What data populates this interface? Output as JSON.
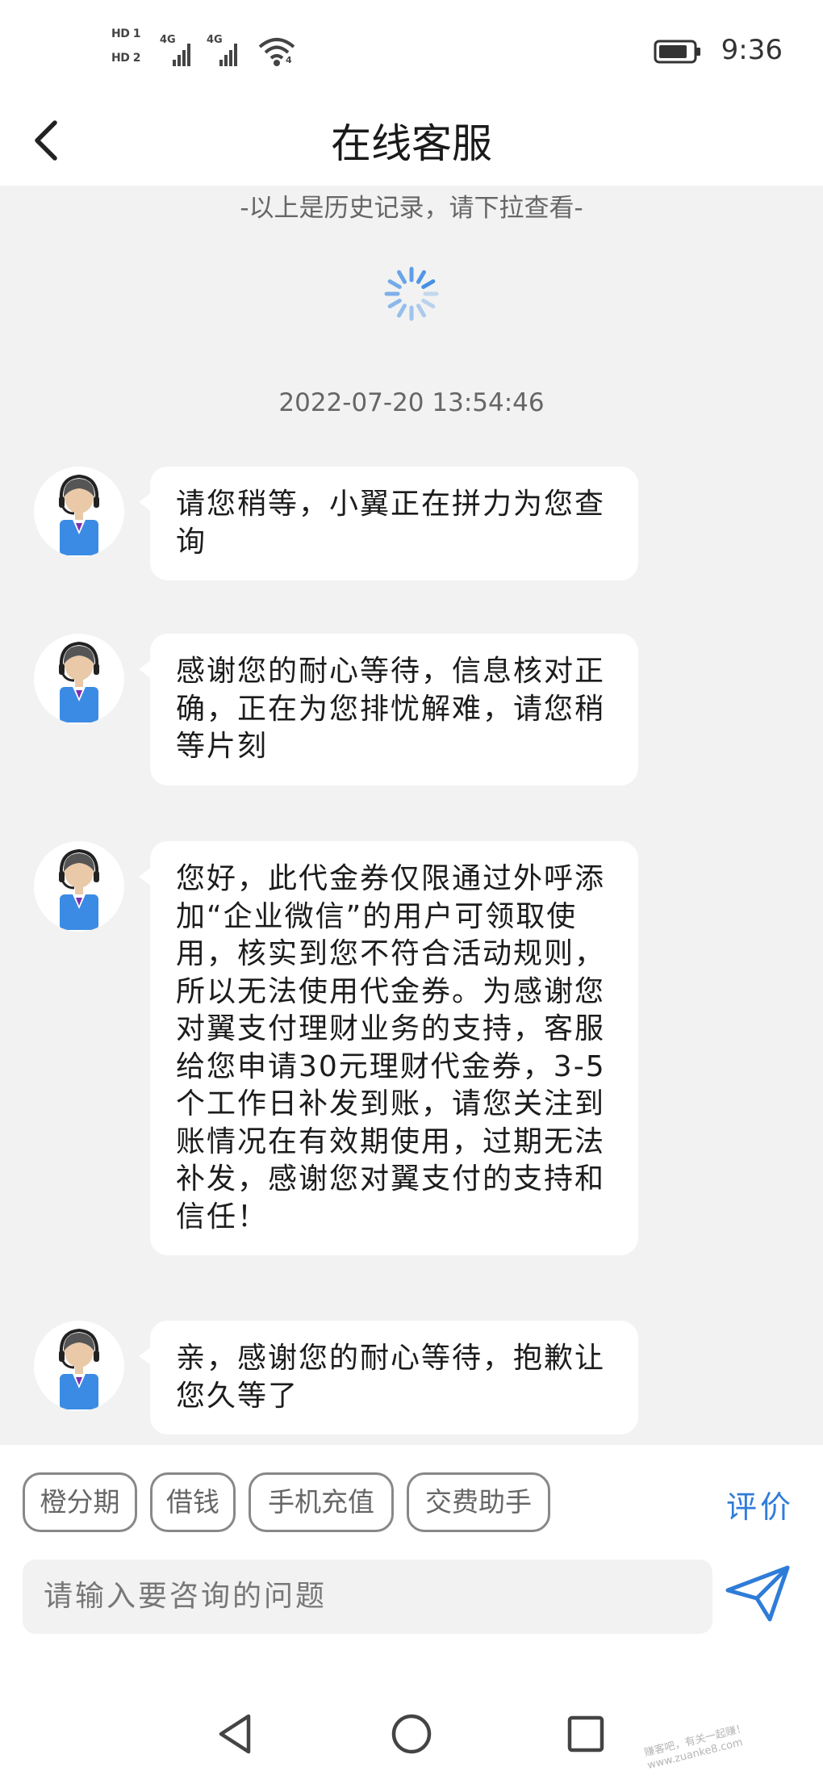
{
  "status_bar": {
    "sim1": "HD 1",
    "sim2": "HD 2",
    "net1": "4G",
    "net2": "4G",
    "wifi_label": "4",
    "time": "9:36",
    "icons": [
      "signal-icon",
      "wifi-icon",
      "battery-icon"
    ]
  },
  "header": {
    "title": "在线客服"
  },
  "chat": {
    "history_hint": "-以上是历史记录，请下拉查看-",
    "timestamp": "2022-07-20 13:54:46",
    "messages": [
      {
        "sender": "agent",
        "text": "请您稍等，小翼正在拼力为您查询"
      },
      {
        "sender": "agent",
        "text": "感谢您的耐心等待，信息核对正确，正在为您排忧解难，请您稍等片刻"
      },
      {
        "sender": "agent",
        "text": "您好，此代金券仅限通过外呼添加“企业微信”的用户可领取使用，核实到您不符合活动规则，所以无法使用代金券。为感谢您对翼支付理财业务的支持，客服给您申请30元理财代金券，3-5个工作日补发到账，请您关注到账情况在有效期使用，过期无法补发，感谢您对翼支付的支持和信任！"
      },
      {
        "sender": "agent",
        "text": "亲，感谢您的耐心等待，抱歉让您久等了"
      }
    ]
  },
  "quick_actions": [
    "橙分期",
    "借钱",
    "手机充值",
    "交费助手"
  ],
  "rate_label": "评价",
  "input": {
    "placeholder": "请输入要咨询的问题"
  },
  "watermark": {
    "line1": "赚客吧，有关一起赚！",
    "line2": "www.zuanke8.com"
  },
  "colors": {
    "accent": "#2f7cd8",
    "chat_background": "#f2f2f2",
    "bubble": "#ffffff"
  }
}
